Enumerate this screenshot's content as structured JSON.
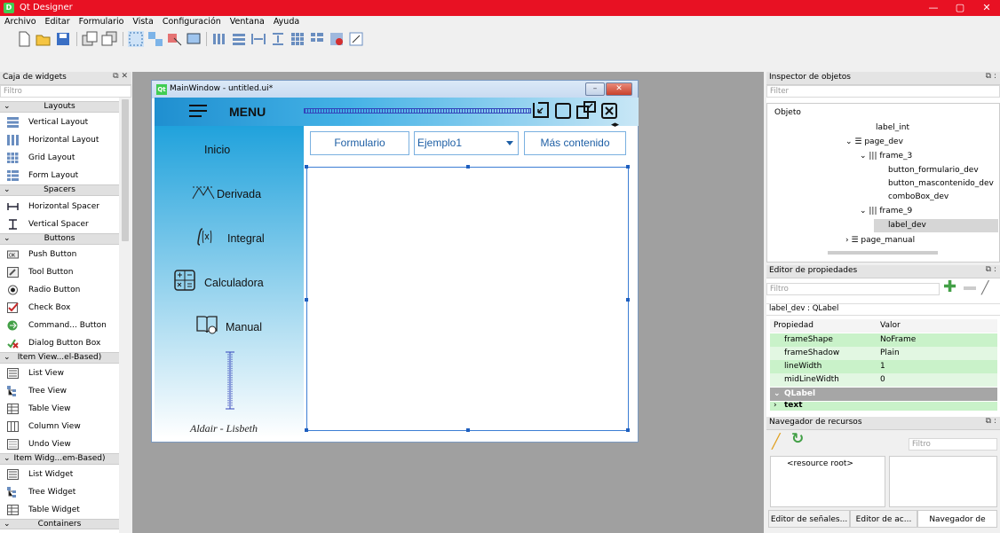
{
  "titlebar": {
    "app_title": "Qt Designer",
    "qt_badge": "D",
    "min": "—",
    "max": "▢",
    "close": "✕"
  },
  "menubar": [
    "Archivo",
    "Editar",
    "Formulario",
    "Vista",
    "Configuración",
    "Ventana",
    "Ayuda"
  ],
  "widget_box": {
    "title": "Caja de widgets",
    "filter_placeholder": "Filtro",
    "categories": [
      "Layouts",
      "Spacers",
      "Buttons",
      "Item View...el-Based)",
      "Item Widg...em-Based)",
      "Containers"
    ],
    "items": [
      "Vertical Layout",
      "Horizontal Layout",
      "Grid Layout",
      "Form Layout",
      "Horizontal Spacer",
      "Vertical Spacer",
      "Push Button",
      "Tool Button",
      "Radio Button",
      "Check Box",
      "Command... Button",
      "Dialog Button Box",
      "List View",
      "Tree View",
      "Table View",
      "Column View",
      "Undo View",
      "List Widget",
      "Tree Widget",
      "Table Widget"
    ]
  },
  "main_window": {
    "title": "MainWindow - untitled.ui*",
    "qt_badge": "Qt",
    "header": {
      "menu_label": "MENU"
    },
    "sidebar": {
      "items": [
        "Inicio",
        "Derivada",
        "Integral",
        "Calculadora",
        "Manual"
      ],
      "signature": "Aldair - Lisbeth"
    },
    "content": {
      "btn_formulario": "Formulario",
      "combo_value": "Ejemplo1",
      "btn_mas": "Más contenido"
    }
  },
  "inspector": {
    "title": "Inspector de objetos",
    "filter_placeholder": "Filter",
    "column": "Objeto",
    "tree": [
      "label_int",
      "page_dev",
      "frame_3",
      "button_formulario_dev",
      "button_mascontenido_dev",
      "comboBox_dev",
      "frame_9",
      "label_dev",
      "page_manual"
    ]
  },
  "property_editor": {
    "title": "Editor de propiedades",
    "filter_placeholder": "Filtro",
    "object_label": "label_dev : QLabel",
    "col_prop": "Propiedad",
    "col_val": "Valor",
    "rows": [
      {
        "name": "frameShape",
        "value": "NoFrame"
      },
      {
        "name": "frameShadow",
        "value": "Plain"
      },
      {
        "name": "lineWidth",
        "value": "1"
      },
      {
        "name": "midLineWidth",
        "value": "0"
      }
    ],
    "section": "QLabel",
    "next_prop": "text"
  },
  "resource_browser": {
    "title": "Navegador de recursos",
    "filter_placeholder": "Filtro",
    "root": "<resource root>",
    "tabs": [
      "Editor de señales...",
      "Editor de ac...",
      "Navegador de rec..."
    ]
  },
  "colors": {
    "titlebar": "#e81123",
    "accent": "#20a2dc",
    "selection": "#1f5fbf"
  }
}
